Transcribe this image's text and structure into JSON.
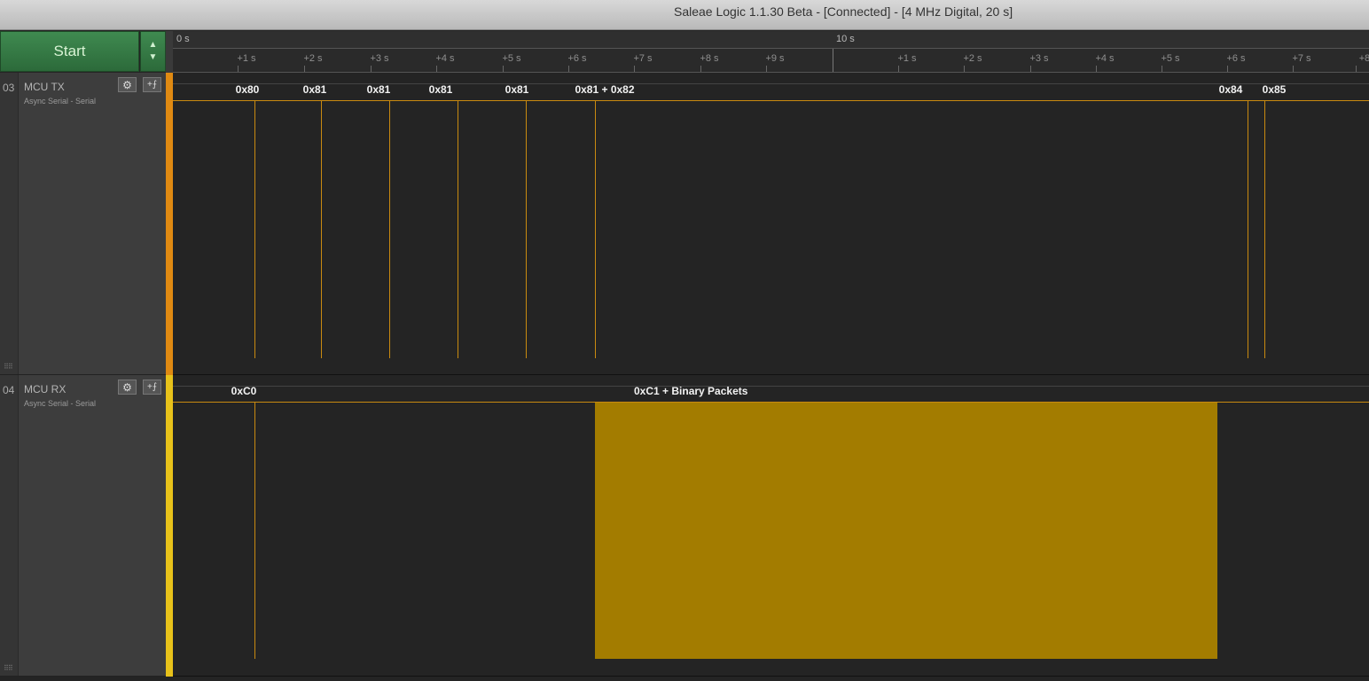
{
  "window": {
    "title": "Saleae Logic 1.1.30 Beta - [Connected] - [4 MHz Digital, 20 s]"
  },
  "toolbar": {
    "start_label": "Start",
    "up_arrow": "▲",
    "down_arrow": "▼"
  },
  "ruler": {
    "major": [
      "0 s",
      "10 s"
    ],
    "minor": [
      "+1 s",
      "+2 s",
      "+3 s",
      "+4 s",
      "+5 s",
      "+6 s",
      "+7 s",
      "+8 s",
      "+9 s",
      "+1 s",
      "+2 s",
      "+3 s",
      "+4 s",
      "+5 s",
      "+6 s",
      "+7 s",
      "+8"
    ]
  },
  "channels": [
    {
      "number": "03",
      "name": "MCU TX",
      "analyzer": "Async Serial - Serial",
      "color": "#e08a12",
      "labels": [
        "0x80",
        "0x81",
        "0x81",
        "0x81",
        "0x81",
        "0x81 + 0x82",
        "0x84",
        "0x85"
      ]
    },
    {
      "number": "04",
      "name": "MCU RX",
      "analyzer": "Async Serial - Serial",
      "color": "#e8c21a",
      "labels": [
        "0xC0",
        "0xC1 + Binary Packets"
      ]
    }
  ],
  "buttons": {
    "gear": "⚙",
    "trigger": "+⨍"
  },
  "grip": "⠿⠿"
}
